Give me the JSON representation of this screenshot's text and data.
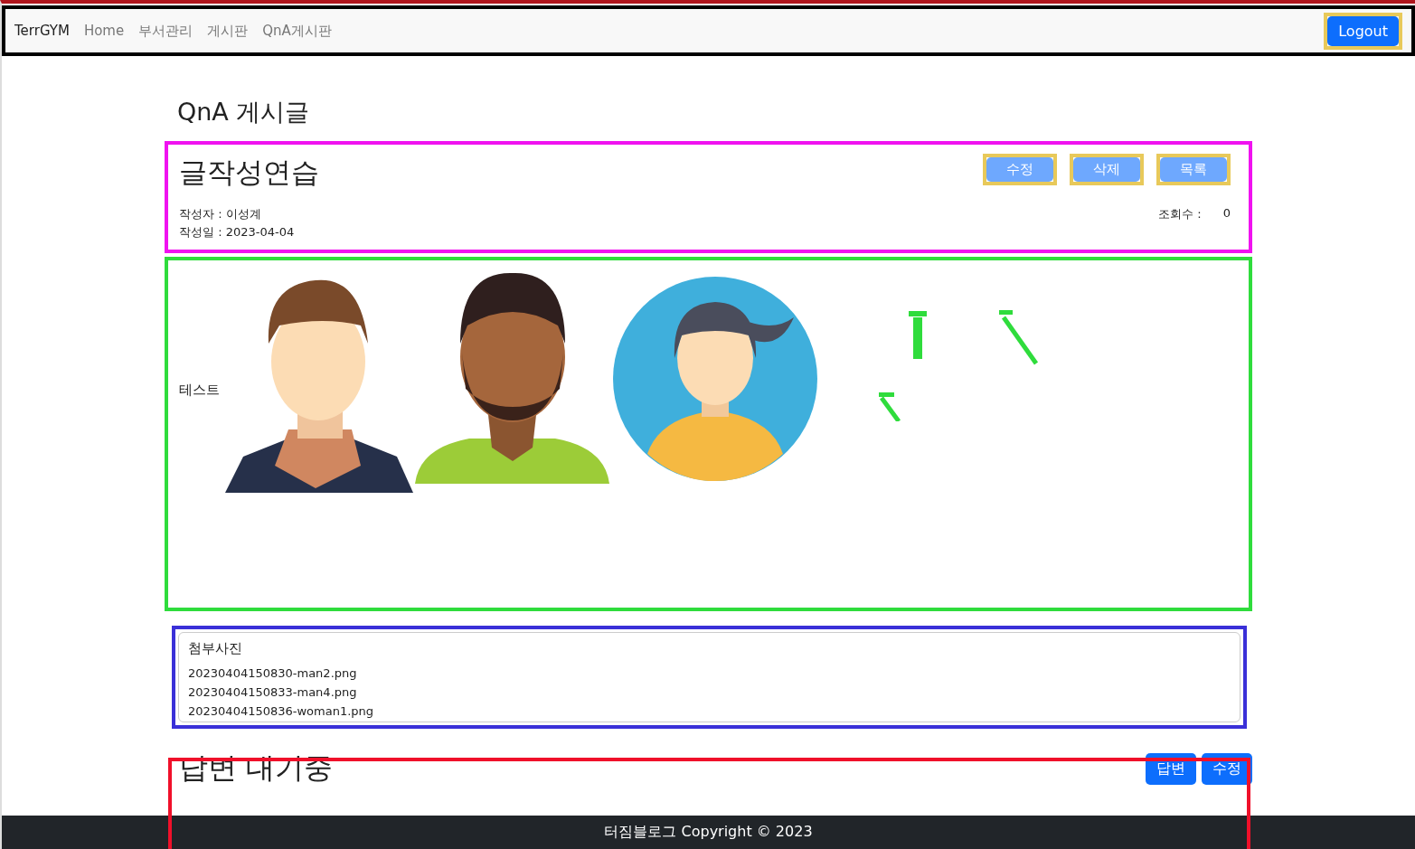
{
  "navbar": {
    "brand": "TerrGYM",
    "links": [
      "Home",
      "부서관리",
      "게시판",
      "QnA게시판"
    ],
    "logout": "Logout"
  },
  "page_title": "QnA 게시글",
  "post": {
    "title": "글작성연습",
    "buttons": [
      "수정",
      "삭제",
      "목록"
    ],
    "author": "작성자 : 이성계",
    "date": "작성일 : 2023-04-04",
    "views_label": "조회수 :",
    "views": "0"
  },
  "content": {
    "text": "테스트",
    "images": [
      {
        "kind": "man-curly"
      },
      {
        "kind": "man-beard"
      },
      {
        "kind": "woman-circle"
      }
    ]
  },
  "attachments": {
    "title": "첨부사진",
    "files": [
      "20230404150830-man2.png",
      "20230404150833-man4.png",
      "20230404150836-woman1.png"
    ]
  },
  "answer": {
    "status": "답변 대기중",
    "buttons": [
      "답변",
      "수정"
    ]
  },
  "footer": "터짐블로그 Copyright © 2023"
}
